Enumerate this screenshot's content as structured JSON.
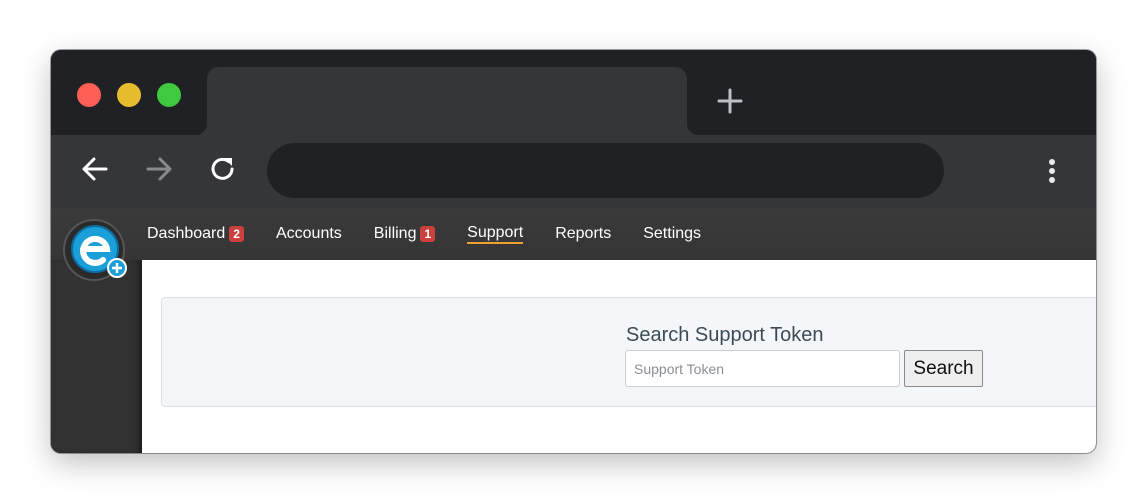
{
  "browser": {
    "tab_title": "",
    "address": "",
    "new_tab_icon": "plus-icon",
    "back_icon": "arrow-left-icon",
    "forward_icon": "arrow-right-icon",
    "reload_icon": "reload-icon",
    "menu_icon": "kebab-menu-icon"
  },
  "app": {
    "logo_icon": "e-plus-logo",
    "nav": [
      {
        "label": "Dashboard",
        "badge": "2",
        "active": false
      },
      {
        "label": "Accounts",
        "badge": null,
        "active": false
      },
      {
        "label": "Billing",
        "badge": "1",
        "active": false
      },
      {
        "label": "Support",
        "badge": null,
        "active": true
      },
      {
        "label": "Reports",
        "badge": null,
        "active": false
      },
      {
        "label": "Settings",
        "badge": null,
        "active": false
      }
    ],
    "colors": {
      "active_underline": "#f0a030",
      "badge": "#c9403c",
      "logo_blue": "#1a9fd9"
    }
  },
  "support": {
    "title": "Search Support Token",
    "input_value": "",
    "input_placeholder": "Support Token",
    "search_button": "Search"
  }
}
